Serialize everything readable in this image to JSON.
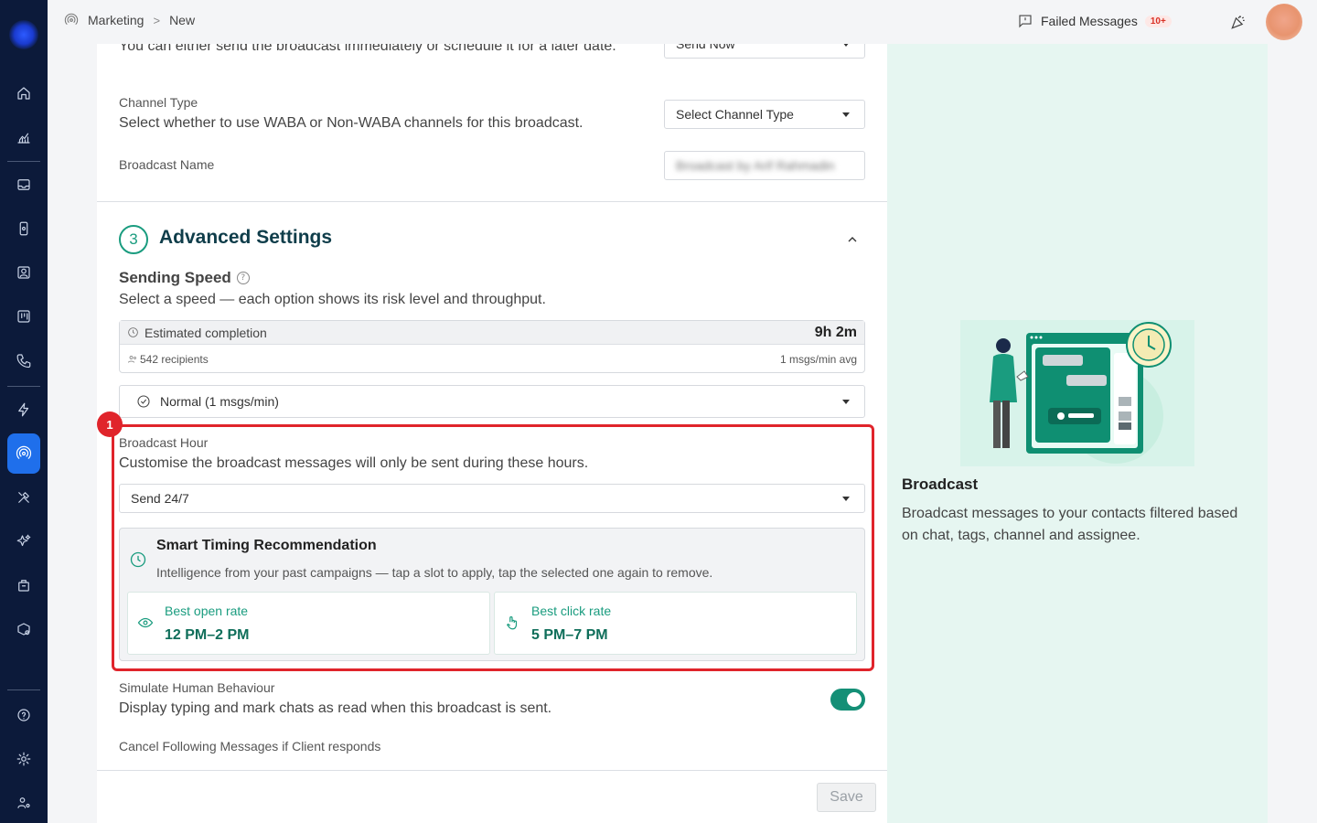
{
  "breadcrumb": {
    "root": "Marketing",
    "current": "New"
  },
  "header": {
    "failed_label": "Failed Messages",
    "failed_badge": "10+"
  },
  "schedule": {
    "desc": "You can either send the broadcast immediately or schedule it for a later date.",
    "value": "Send Now"
  },
  "channel": {
    "label": "Channel Type",
    "desc": "Select whether to use WABA or Non-WABA channels for this broadcast.",
    "value": "Select Channel Type"
  },
  "broadcast_name": {
    "label": "Broadcast Name",
    "value": "Broadcast by Arif Rahmadin"
  },
  "advanced": {
    "step": "3",
    "title": "Advanced Settings"
  },
  "speed": {
    "label": "Sending Speed",
    "desc": "Select a speed — each option shows its risk level and throughput.",
    "est_label": "Estimated completion",
    "est_value": "9h 2m",
    "recipients": "542 recipients",
    "avg": "1 msgs/min avg",
    "selected": "Normal (1 msgs/min)"
  },
  "annotation": {
    "number": "1"
  },
  "hour": {
    "label": "Broadcast Hour",
    "desc": "Customise the broadcast messages will only be sent during these hours.",
    "value": "Send 24/7"
  },
  "smart": {
    "title": "Smart Timing Recommendation",
    "desc": "Intelligence from your past campaigns — tap a slot to apply, tap the selected one again to remove.",
    "slots": [
      {
        "label": "Best open rate",
        "time": "12 PM–2 PM",
        "icon": "eye-icon"
      },
      {
        "label": "Best click rate",
        "time": "5 PM–7 PM",
        "icon": "pointer-icon"
      }
    ]
  },
  "simulate": {
    "label": "Simulate Human Behaviour",
    "desc": "Display typing and mark chats as read when this broadcast is sent.",
    "enabled": true
  },
  "cancel": {
    "label": "Cancel Following Messages if Client responds"
  },
  "footer": {
    "save": "Save"
  },
  "right": {
    "title": "Broadcast",
    "desc": "Broadcast messages to your contacts filtered based on chat, tags, channel and assignee."
  },
  "colors": {
    "accent": "#1a9c7f",
    "sidebar": "#0c1a3a",
    "active": "#1f6feb",
    "highlight": "#e0242b"
  }
}
